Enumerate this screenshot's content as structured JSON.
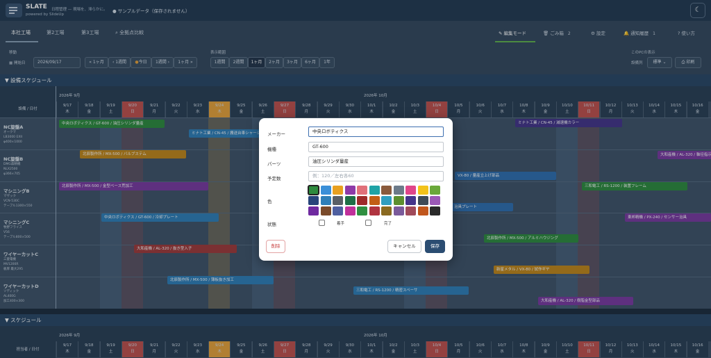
{
  "app": {
    "name": "SLATE",
    "powered": "powered by SlideUp",
    "tagline": "日程管理 — 現場を、滞らかに。",
    "sample_notice": "サンプルデータ（保存されません）",
    "theme_icon": "moon-icon"
  },
  "nav": {
    "tabs": [
      {
        "label": "本社工場"
      },
      {
        "label": "第2工場"
      },
      {
        "label": "第3工場"
      },
      {
        "label": "全拠点比較"
      }
    ],
    "edit_mode": "編集モード",
    "trash": "ごみ箱",
    "trash_count": "2",
    "settings": "設定",
    "notifications": "通知履歴",
    "notif_count": "1",
    "howto": "使い方"
  },
  "toolbar": {
    "move_label": "移動",
    "start_label": "開始日",
    "start_date": "2026/09/17",
    "prev_month": "« 1ヶ月",
    "prev_week": "‹ 1週間",
    "today": "今日",
    "next_week": "1週間 ›",
    "next_month": "1ヶ月 »",
    "range_label": "表示範囲",
    "ranges": [
      "1週間",
      "2週間",
      "1ヶ月",
      "2ヶ月",
      "3ヶ月",
      "6ヶ月",
      "1年"
    ],
    "range_selected": "1ヶ月",
    "pc_label": "このPCの表示",
    "order_label": "設備列",
    "order_value": "標準",
    "print": "印刷"
  },
  "colors": {
    "accent": "#2b4d72",
    "edit": "#62b34c",
    "holiday": "#c0504d",
    "today": "#e8a33a"
  },
  "equipment_section": {
    "title": "▼ 設備スケジュール",
    "month1": "2026年 9月",
    "month2": "2026年 10月",
    "corner": "設備 / 日付",
    "days": [
      [
        "9/17",
        "木"
      ],
      [
        "9/18",
        "金"
      ],
      [
        "9/19",
        "土"
      ],
      [
        "9/20",
        "日"
      ],
      [
        "9/21",
        "月"
      ],
      [
        "9/22",
        "火"
      ],
      [
        "9/23",
        "水"
      ],
      [
        "9/24",
        "木"
      ],
      [
        "9/25",
        "金"
      ],
      [
        "9/26",
        "土"
      ],
      [
        "9/27",
        "日"
      ],
      [
        "9/28",
        "月"
      ],
      [
        "9/29",
        "火"
      ],
      [
        "9/30",
        "水"
      ],
      [
        "10/1",
        "木"
      ],
      [
        "10/2",
        "金"
      ],
      [
        "10/3",
        "土"
      ],
      [
        "10/4",
        "日"
      ],
      [
        "10/5",
        "月"
      ],
      [
        "10/6",
        "火"
      ],
      [
        "10/7",
        "水"
      ],
      [
        "10/8",
        "木"
      ],
      [
        "10/9",
        "金"
      ],
      [
        "10/10",
        "土"
      ],
      [
        "10/11",
        "日"
      ],
      [
        "10/12",
        "月"
      ],
      [
        "10/13",
        "火"
      ],
      [
        "10/14",
        "水"
      ],
      [
        "10/15",
        "木"
      ],
      [
        "10/16",
        "金"
      ]
    ],
    "rows": [
      {
        "name": "NC旋盤A",
        "lines": [
          "オークマ",
          "LB3000 EXII",
          "φ400×1000"
        ]
      },
      {
        "name": "NC旋盤B",
        "lines": [
          "DMG森精機",
          "NLX2500",
          "φ366×705"
        ]
      },
      {
        "name": "マシニングB",
        "lines": [
          "マザック",
          "VCN-530C",
          "テーブル1300×550"
        ]
      },
      {
        "name": "マシニングC",
        "lines": [
          "牧野フライス",
          "V56",
          "テーブル800×500"
        ]
      },
      {
        "name": "ワイヤーカットC",
        "lines": [
          "三菱電機",
          "MV1200R",
          "板厚 最大295"
        ]
      },
      {
        "name": "ワイヤーカットD",
        "lines": [
          "ソディック",
          "AL400G",
          "加工400×300"
        ]
      }
    ],
    "bars": [
      {
        "text": "中央ロボティクス / GT-600 / 油圧シリンダ量産"
      },
      {
        "text": "ミナト工業 / CN-45 / 搬送台車シャーシ"
      },
      {
        "text": "ミナト工業 / CN-45 / 減速機カラー"
      },
      {
        "text": "北辰製作所 / MX-500 / バルブステム"
      },
      {
        "text": "大和産機 / AL-320 / 軸径指示"
      },
      {
        "text": "VX-80 / 量産立上げ部品"
      },
      {
        "text": "北辰製作所 / MX-500 / 金型ベース荒加工"
      },
      {
        "text": "三和電工 / RS-1200 / 装置フレーム"
      },
      {
        "text": "治具プレート"
      },
      {
        "text": "中央ロボティクス / GT-600 / 冷却プレート"
      },
      {
        "text": "東邦精機 / PX-240 / センサー治具"
      },
      {
        "text": "北辰製作所 / MX-500 / アルミハウジング"
      },
      {
        "text": "大和産機 / AL-320 / 抜き型入子"
      },
      {
        "text": "新星メタル / VX-80 / 試作ギヤ"
      },
      {
        "text": "北辰製作所 / MX-500 / 薄板抜き加工"
      },
      {
        "text": "三和電工 / RS-1200 / 精密スペーサ"
      },
      {
        "text": "大和産機 / AL-320 / 樹脂金型部品"
      }
    ]
  },
  "staff_section": {
    "title": "▼ スケジュール",
    "month1": "2026年 9月",
    "month2": "2026年 10月",
    "corner": "担当者 / 日付"
  },
  "dialog": {
    "maker_label": "メーカー",
    "maker_value": "中央ロボティクス",
    "model_label": "機種",
    "model_value": "GT-600",
    "parts_label": "パーツ",
    "parts_value": "油圧シリンダ量産",
    "qty_label": "予定数",
    "qty_placeholder": "例：120／左右各60",
    "color_label": "色",
    "status_label": "状態",
    "started_label": "着手",
    "done_label": "完了",
    "delete_label": "削除",
    "cancel_label": "キャンセル",
    "save_label": "保存",
    "palette": [
      "#2e8b3e",
      "#3a8fd8",
      "#e8a020",
      "#8e3aa8",
      "#e0707a",
      "#1fa3a6",
      "#8a5a3c",
      "#6c7a89",
      "#e0458a",
      "#f2c21a",
      "#6aa83a",
      "#27447a",
      "#2f7fb8",
      "#5a5f66",
      "#1e6e46",
      "#9e2a2a",
      "#c25e16",
      "#2f9ec0",
      "#5c8e2e",
      "#44348a",
      "#3d4a57",
      "#9b59b6",
      "#6f2aa0",
      "#7a4a2a",
      "#4f5fa0",
      "#c0309a",
      "#2f8f40",
      "#b03440",
      "#8a6a20",
      "#7a5a9a",
      "#a04a5a",
      "#c0561c",
      "#2a2a2a"
    ]
  }
}
